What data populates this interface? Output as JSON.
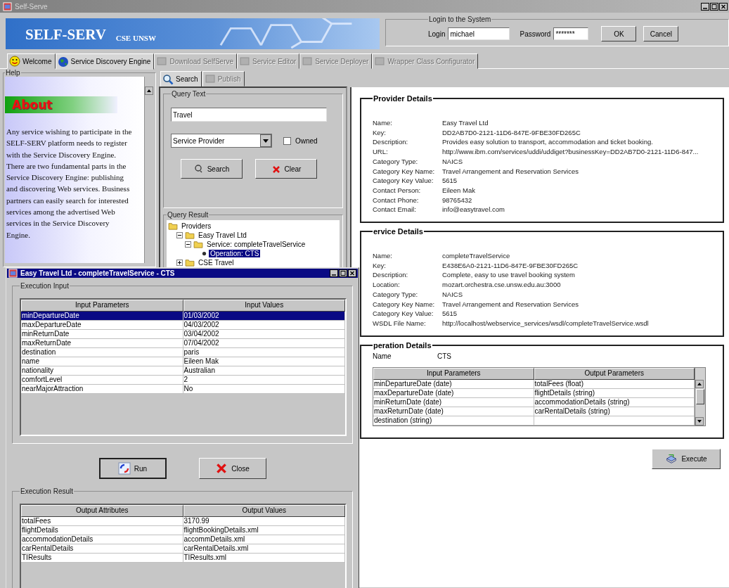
{
  "window": {
    "title": "Self-Serve"
  },
  "banner": {
    "title": "SELF-SERV",
    "subtitle": "CSE UNSW"
  },
  "login": {
    "legend": "Login to the System",
    "login_label": "Login",
    "login_value": "michael",
    "password_label": "Password",
    "password_value": "*******",
    "buttons": [
      "OK",
      "Cancel"
    ]
  },
  "main_tabs": [
    {
      "label": "Welcome",
      "kind": "smiley",
      "selected": false,
      "disabled": false
    },
    {
      "label": "Service Discovery Engine",
      "kind": "globe",
      "selected": true,
      "disabled": false
    },
    {
      "label": "Download SelfServe",
      "kind": "box",
      "selected": false,
      "disabled": true
    },
    {
      "label": "Service Editor",
      "kind": "box",
      "selected": false,
      "disabled": true
    },
    {
      "label": "Service Deployer",
      "kind": "box",
      "selected": false,
      "disabled": true
    },
    {
      "label": "Wrapper Class Configurator",
      "kind": "box",
      "selected": false,
      "disabled": true
    }
  ],
  "help": {
    "legend": "Help",
    "heading": "About",
    "text": "Any service wishing to participate in the SELF-SERV platform needs to register with the Service Discovery Engine. There are two fundamental parts in the Service Discovery Engine: publishing and discovering Web services. Business partners can easily search for interested services among the advertised Web services in the Service Discovery Engine."
  },
  "search_tabs": [
    {
      "label": "Search",
      "kind": "search",
      "selected": true,
      "disabled": false
    },
    {
      "label": "Publish",
      "kind": "box",
      "selected": false,
      "disabled": true
    }
  ],
  "query_text": {
    "legend": "Query Text",
    "value": "Travel",
    "type_value": "Service Provider",
    "owned": {
      "label": "Owned",
      "checked": false
    },
    "buttons": [
      {
        "label": "Search",
        "kind": "search"
      },
      {
        "label": "Clear",
        "kind": "clear"
      }
    ]
  },
  "query_result": {
    "legend": "Query Result",
    "tree": [
      {
        "label": "Providers",
        "selected": false,
        "children": [
          {
            "label": "Easy Travel Ltd",
            "expanded": true,
            "selected": false,
            "children": [
              {
                "label": "Service: completeTravelService",
                "expanded": true,
                "selected": false,
                "children": [
                  {
                    "label": "Operation: CTS",
                    "kind": "leaf",
                    "selected": true
                  }
                ]
              }
            ]
          },
          {
            "label": "CSE Travel",
            "expanded": false,
            "selected": false
          }
        ]
      }
    ]
  },
  "provider_details": {
    "legend": "Provider Details",
    "fields": [
      {
        "label": "Name:",
        "value": "Easy Travel Ltd"
      },
      {
        "label": "Key:",
        "value": "DD2AB7D0-2121-11D6-847E-9FBE30FD265C"
      },
      {
        "label": "Description:",
        "value": "Provides easy solution to transport, accommodation and ticket booking."
      },
      {
        "label": "URL:",
        "value": "http://www.ibm.com/services/uddi/uddiget?businessKey=DD2AB7D0-2121-11D6-847..."
      },
      {
        "label": "Category Type:",
        "value": "NAICS"
      },
      {
        "label": "Category Key Name:",
        "value": "Travel Arrangement and Reservation Services"
      },
      {
        "label": "Category Key Value:",
        "value": "5615"
      },
      {
        "label": "Contact Person:",
        "value": "Eileen Mak"
      },
      {
        "label": "Contact Phone:",
        "value": "98765432"
      },
      {
        "label": "Contact Email:",
        "value": "info@easytravel.com"
      }
    ]
  },
  "service_details": {
    "legend": "ervice Details",
    "fields": [
      {
        "label": "Name:",
        "value": "completeTravelService"
      },
      {
        "label": "Key:",
        "value": "E438E6A0-2121-11D6-847E-9FBE30FD265C"
      },
      {
        "label": "Description:",
        "value": "Complete, easy to use travel booking system"
      },
      {
        "label": "Location:",
        "value": "mozart.orchestra.cse.unsw.edu.au:3000"
      },
      {
        "label": "Category Type:",
        "value": "NAICS"
      },
      {
        "label": "Category Key Name:",
        "value": "Travel Arrangement and Reservation Services"
      },
      {
        "label": "Category Key Value:",
        "value": "5615"
      },
      {
        "label": "WSDL File Name:",
        "value": "http://localhost/webservice_services/wsdl/completeTravelService.wsdl"
      }
    ]
  },
  "operation_details": {
    "legend": "peration Details",
    "name_label": "Name",
    "name_value": "CTS",
    "columns": [
      "Input Parameters",
      "Output Parameters"
    ],
    "rows": [
      {
        "input": "minDepartureDate (date)",
        "output": "totalFees (float)"
      },
      {
        "input": "maxDepartureDate (date)",
        "output": "flightDetails (string)"
      },
      {
        "input": "minReturnDate (date)",
        "output": "accommodationDetails (string)"
      },
      {
        "input": "maxReturnDate (date)",
        "output": "carRentalDetails (string)"
      },
      {
        "input": "destination (string)"
      }
    ]
  },
  "execute_button": "Execute",
  "dialog": {
    "title": "Easy Travel Ltd - completeTravelService - CTS",
    "input_legend": "Execution Input",
    "input_columns": [
      "Input Parameters",
      "Input Values"
    ],
    "input_rows": [
      {
        "param": "minDepartureDate",
        "value": "01/03/2002",
        "selected": true
      },
      {
        "param": "maxDepartureDate",
        "value": "04/03/2002",
        "selected": false
      },
      {
        "param": "minReturnDate",
        "value": "03/04/2002",
        "selected": false
      },
      {
        "param": "maxReturnDate",
        "value": "07/04/2002",
        "selected": false
      },
      {
        "param": "destination",
        "value": "paris",
        "selected": false
      },
      {
        "param": "name",
        "value": "Eileen Mak",
        "selected": false
      },
      {
        "param": "nationality",
        "value": "Australian",
        "selected": false
      },
      {
        "param": "comfortLevel",
        "value": "2",
        "selected": false
      },
      {
        "param": "nearMajorAttraction",
        "value": "No",
        "selected": false
      }
    ],
    "buttons": [
      {
        "label": "Run",
        "kind": "run"
      },
      {
        "label": "Close",
        "kind": "close"
      }
    ],
    "result_legend": "Execution Result",
    "result_columns": [
      "Output Attributes",
      "Output Values"
    ],
    "result_rows": [
      {
        "attribute": "totalFees",
        "value": "3170.99"
      },
      {
        "attribute": "flightDetails",
        "value": "flightBookingDetails.xml"
      },
      {
        "attribute": "accommodationDetails",
        "value": "accommDetails.xml"
      },
      {
        "attribute": "carRentalDetails",
        "value": "carRentalDetails.xml"
      },
      {
        "attribute": "TIResults",
        "value": "TIResults.xml"
      }
    ]
  }
}
